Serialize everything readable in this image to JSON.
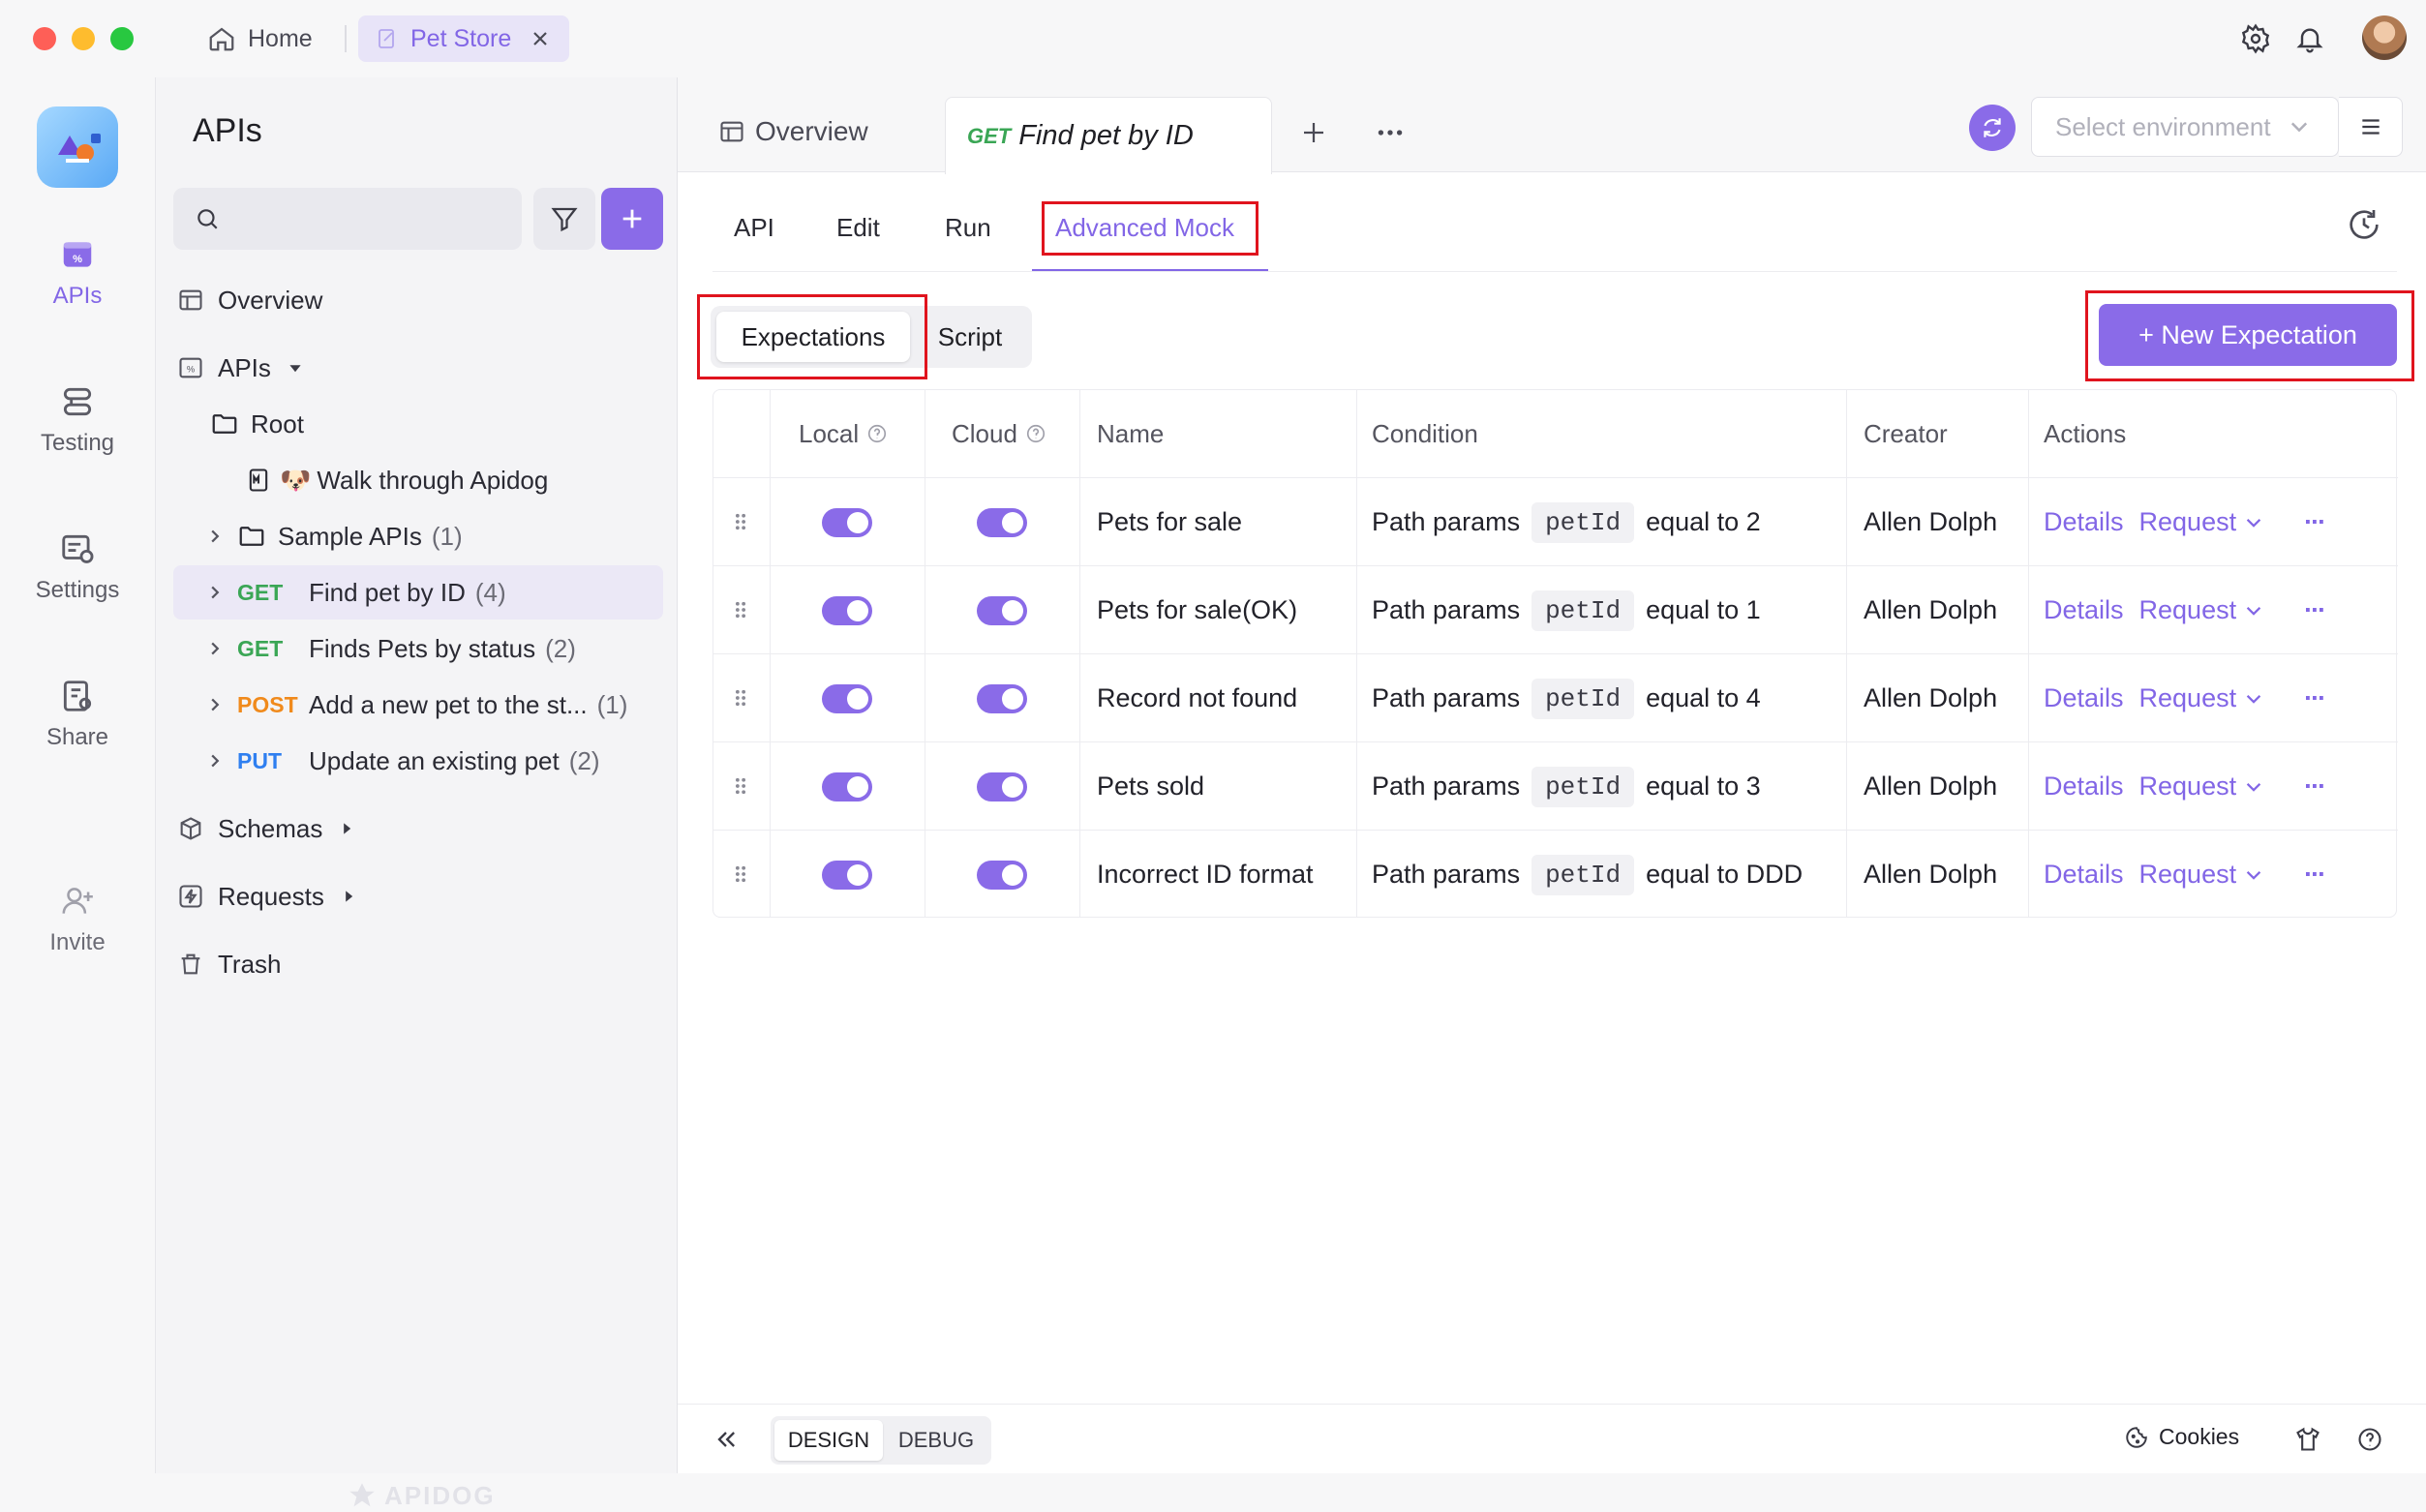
{
  "window": {
    "tabs": [
      {
        "label": "Home"
      },
      {
        "label": "Pet Store"
      }
    ]
  },
  "rail": {
    "items": [
      {
        "label": "APIs"
      },
      {
        "label": "Testing"
      },
      {
        "label": "Settings"
      },
      {
        "label": "Share"
      },
      {
        "label": "Invite"
      }
    ]
  },
  "sidebar": {
    "title": "APIs",
    "search_placeholder": "",
    "tree": {
      "overview": "Overview",
      "apis": "APIs",
      "root": "Root",
      "walk": "Walk through Apidog",
      "walk_emoji": "🐶",
      "sample": {
        "label": "Sample APIs",
        "count": "(1)"
      },
      "endpoints": [
        {
          "method": "GET",
          "label": "Find pet by ID",
          "count": "(4)"
        },
        {
          "method": "GET",
          "label": "Finds Pets by status",
          "count": "(2)"
        },
        {
          "method": "POST",
          "label": "Add a new pet to the st...",
          "count": "(1)"
        },
        {
          "method": "PUT",
          "label": "Update an existing pet",
          "count": "(2)"
        }
      ],
      "schemas": "Schemas",
      "requests": "Requests",
      "trash": "Trash"
    },
    "watermark": "APIDOG"
  },
  "main": {
    "doc_tabs": {
      "overview": "Overview",
      "active_method": "GET",
      "active_label": "Find pet by ID"
    },
    "environment_placeholder": "Select environment",
    "subtabs": [
      "API",
      "Edit",
      "Run",
      "Advanced Mock"
    ],
    "segments": [
      "Expectations",
      "Script"
    ],
    "new_expectation": "+ New Expectation",
    "table": {
      "headers": [
        "Local",
        "Cloud",
        "Name",
        "Condition",
        "Creator",
        "Actions"
      ],
      "rows": [
        {
          "name": "Pets for sale",
          "cond_prefix": "Path params",
          "param": "petId",
          "cond_suffix": "equal to 2",
          "creator": "Allen Dolph"
        },
        {
          "name": "Pets for sale(OK)",
          "cond_prefix": "Path params",
          "param": "petId",
          "cond_suffix": "equal to 1",
          "creator": "Allen Dolph"
        },
        {
          "name": "Record not found",
          "cond_prefix": "Path params",
          "param": "petId",
          "cond_suffix": "equal to 4",
          "creator": "Allen Dolph"
        },
        {
          "name": "Pets sold",
          "cond_prefix": "Path params",
          "param": "petId",
          "cond_suffix": "equal to 3",
          "creator": "Allen Dolph"
        },
        {
          "name": "Incorrect ID format",
          "cond_prefix": "Path params",
          "param": "petId",
          "cond_suffix": "equal to DDD",
          "creator": "Allen Dolph"
        }
      ],
      "action_details": "Details",
      "action_request": "Request",
      "action_more": "···"
    }
  },
  "footer": {
    "modes": [
      "DESIGN",
      "DEBUG"
    ],
    "cookies": "Cookies"
  },
  "colors": {
    "accent": "#8266e6",
    "get": "#3aa655",
    "post": "#f08a1c",
    "put": "#2f7ff0",
    "highlight": "#e0141e"
  }
}
